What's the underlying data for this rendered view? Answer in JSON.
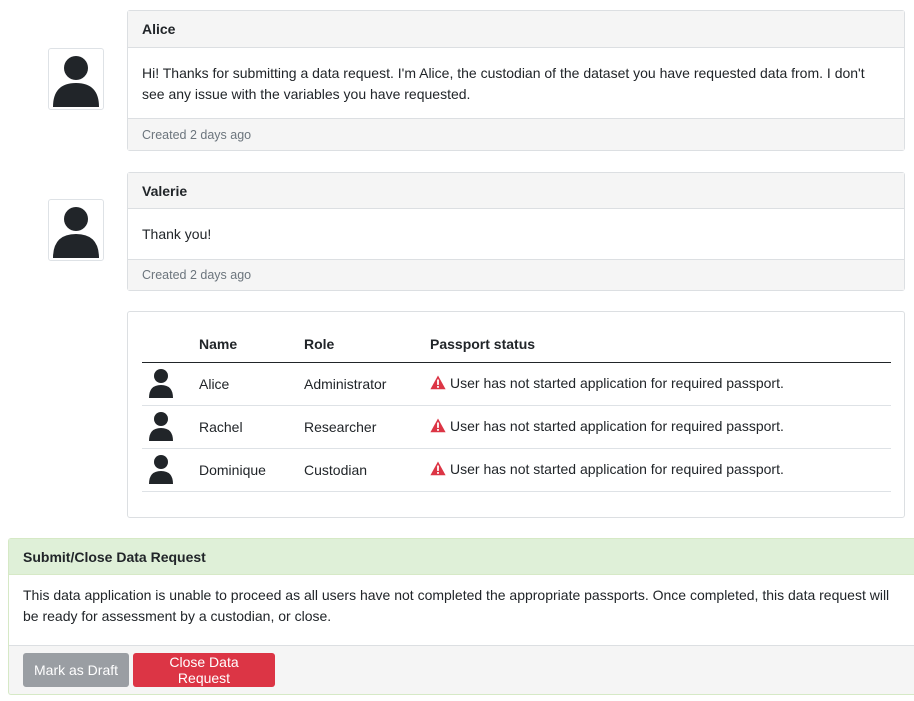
{
  "messages": [
    {
      "author": "Alice",
      "body": "Hi! Thanks for submitting a data request. I'm Alice, the custodian of the dataset you have requested data from. I don't see any issue with the variables you have requested.",
      "created": "Created 2 days ago"
    },
    {
      "author": "Valerie",
      "body": "Thank you!",
      "created": "Created 2 days ago"
    }
  ],
  "users_table": {
    "headers": [
      "Name",
      "Role",
      "Passport status"
    ],
    "rows": [
      {
        "name": "Alice",
        "role": "Administrator",
        "status": "User has not started application for required passport."
      },
      {
        "name": "Rachel",
        "role": "Researcher",
        "status": "User has not started application for required passport."
      },
      {
        "name": "Dominique",
        "role": "Custodian",
        "status": "User has not started application for required passport."
      }
    ]
  },
  "submit_panel": {
    "title": "Submit/Close Data Request",
    "body": "This data application is unable to proceed as all users have not completed the appropriate passports. Once completed, this data request will be ready for assessment by a custodian, or close.",
    "draft_label": "Mark as Draft",
    "close_label": "Close Data Request"
  },
  "colors": {
    "danger": "#dc3545",
    "secondary": "#9a9ea3",
    "success_header": "#dff0d8"
  },
  "icons": [
    "user-avatar-icon",
    "warning-triangle-icon"
  ]
}
